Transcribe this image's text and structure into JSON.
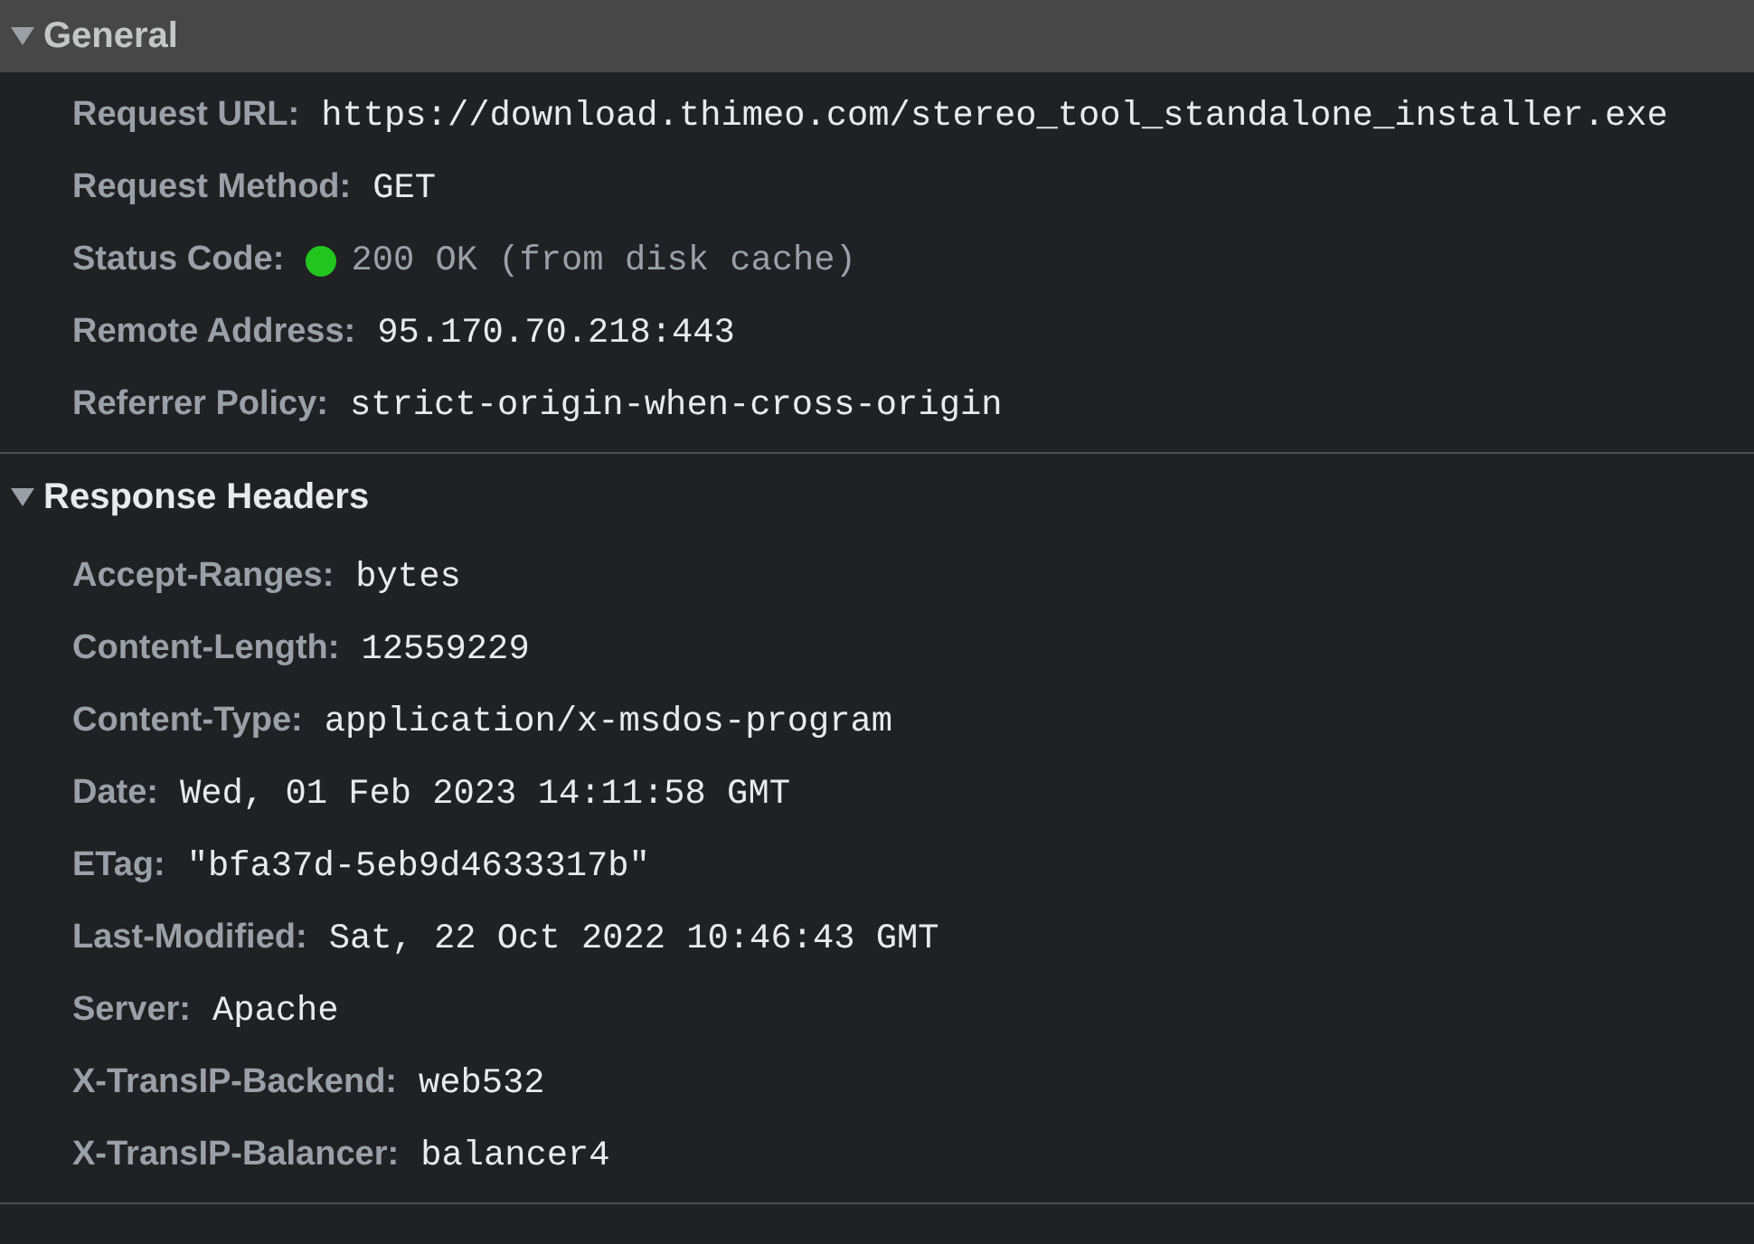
{
  "sections": [
    {
      "title": "General",
      "expanded": true,
      "selected": true,
      "rows": [
        {
          "kind": "plain",
          "name": "Request URL:",
          "value": "https://download.thimeo.com/stereo_tool_standalone_installer.exe"
        },
        {
          "kind": "plain",
          "name": "Request Method:",
          "value": "GET"
        },
        {
          "kind": "status",
          "name": "Status Code:",
          "value": "200 OK (from disk cache)",
          "color": "#22c51e"
        },
        {
          "kind": "plain",
          "name": "Remote Address:",
          "value": "95.170.70.218:443"
        },
        {
          "kind": "plain",
          "name": "Referrer Policy:",
          "value": "strict-origin-when-cross-origin"
        }
      ]
    },
    {
      "title": "Response Headers",
      "expanded": true,
      "selected": false,
      "rows": [
        {
          "kind": "plain",
          "name": "Accept-Ranges:",
          "value": "bytes"
        },
        {
          "kind": "plain",
          "name": "Content-Length:",
          "value": "12559229"
        },
        {
          "kind": "plain",
          "name": "Content-Type:",
          "value": "application/x-msdos-program"
        },
        {
          "kind": "plain",
          "name": "Date:",
          "value": "Wed, 01 Feb 2023 14:11:58 GMT"
        },
        {
          "kind": "plain",
          "name": "ETag:",
          "value": "\"bfa37d-5eb9d4633317b\""
        },
        {
          "kind": "plain",
          "name": "Last-Modified:",
          "value": "Sat, 22 Oct 2022 10:46:43 GMT"
        },
        {
          "kind": "plain",
          "name": "Server:",
          "value": "Apache"
        },
        {
          "kind": "plain",
          "name": "X-TransIP-Backend:",
          "value": "web532"
        },
        {
          "kind": "plain",
          "name": "X-TransIP-Balancer:",
          "value": "balancer4"
        }
      ]
    }
  ]
}
